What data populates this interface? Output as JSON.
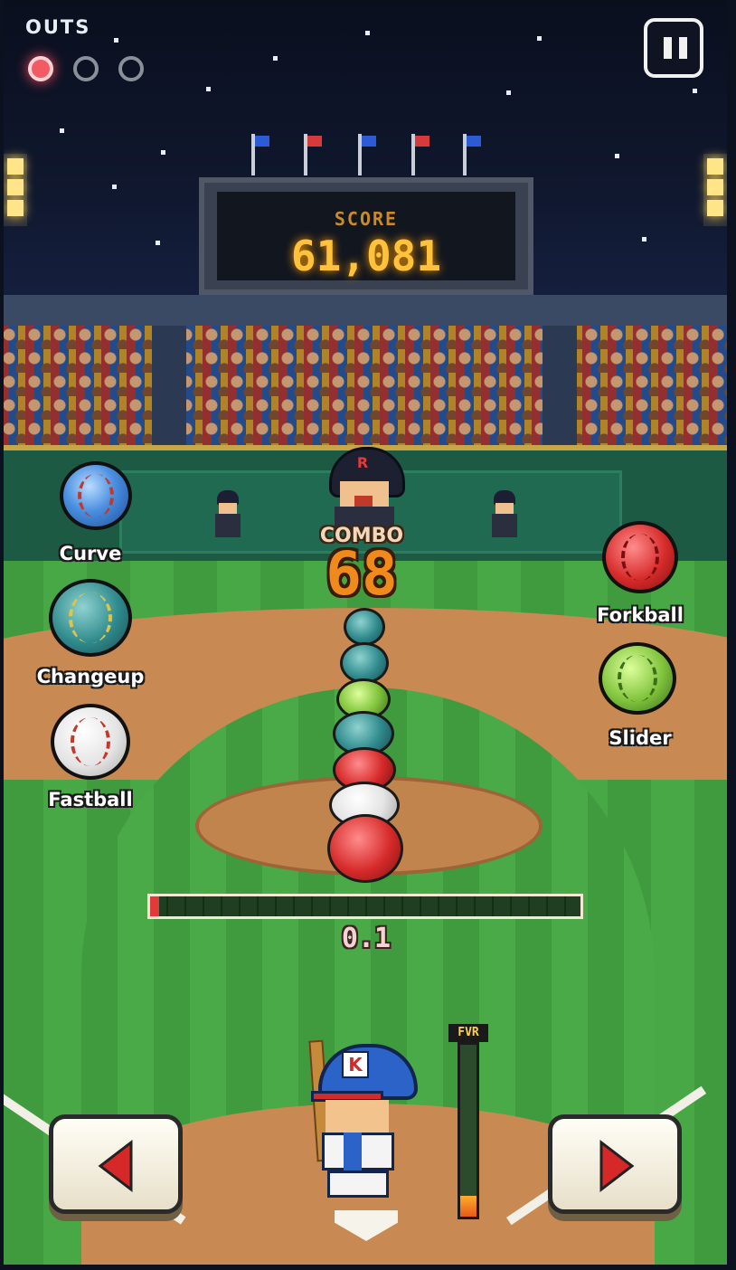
{
  "hud": {
    "outs_label": "OUTS",
    "outs": {
      "count": 1,
      "max": 3
    },
    "pause_icon": "pause-icon"
  },
  "scoreboard": {
    "label": "SCORE",
    "value": "61,081"
  },
  "combo": {
    "label": "COMBO",
    "value": "68"
  },
  "pitches": {
    "left": [
      {
        "label": "Curve",
        "icon": "curve-ball-icon"
      },
      {
        "label": "Changeup",
        "icon": "changeup-ball-icon"
      },
      {
        "label": "Fastball",
        "icon": "fastball-icon"
      }
    ],
    "right": [
      {
        "label": "Forkball",
        "icon": "forkball-icon"
      },
      {
        "label": "Slider",
        "icon": "slider-ball-icon"
      }
    ]
  },
  "progress": {
    "value_text": "0.1",
    "fraction": 0.02
  },
  "fever": {
    "label": "FVR",
    "fraction": 0.12
  },
  "controls": {
    "left_icon": "left-arrow-icon",
    "right_icon": "right-arrow-icon"
  },
  "colors": {
    "out_on": "#f25b64",
    "score_text": "#ffc23a",
    "combo_text": "#f08a1c",
    "arrow_red": "#d62828",
    "progress_fill": "#e03a3a"
  }
}
